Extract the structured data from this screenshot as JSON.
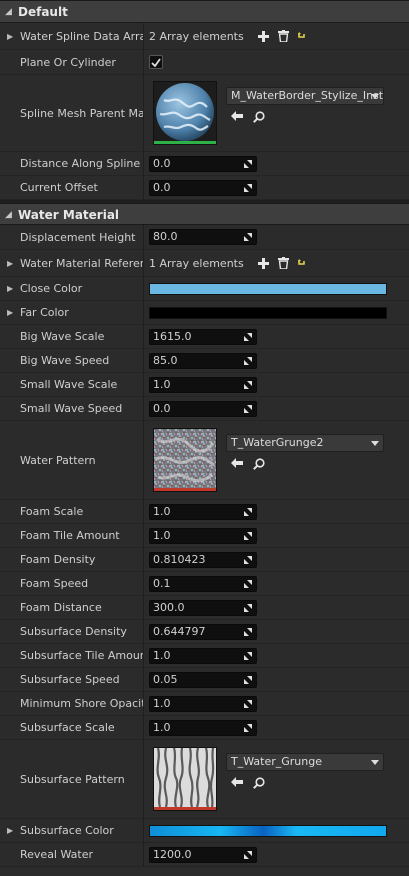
{
  "categories": {
    "default": "Default",
    "water_material": "Water Material"
  },
  "default_rows": {
    "water_spline_data_array": {
      "label": "Water Spline Data Array",
      "value": "2 Array elements"
    },
    "plane_or_cylinder": {
      "label": "Plane Or Cylinder",
      "checked": true
    },
    "spline_mesh_parent": {
      "label": "Spline Mesh Parent Material",
      "asset": "M_WaterBorder_Stylize_Inst"
    },
    "distance_along_spline": {
      "label": "Distance Along Spline",
      "value": "0.0"
    },
    "current_offset": {
      "label": "Current Offset",
      "value": "0.0"
    }
  },
  "water_rows": {
    "displacement_height": {
      "label": "Displacement Height",
      "value": "80.0"
    },
    "water_material_reference": {
      "label": "Water Material Reference",
      "value": "1 Array elements"
    },
    "close_color": {
      "label": "Close Color",
      "color": "#6ab8e2"
    },
    "far_color": {
      "label": "Far Color",
      "color": "#000000"
    },
    "big_wave_scale": {
      "label": "Big Wave Scale",
      "value": "1615.0"
    },
    "big_wave_speed": {
      "label": "Big Wave Speed",
      "value": "85.0"
    },
    "small_wave_scale": {
      "label": "Small Wave Scale",
      "value": "1.0"
    },
    "small_wave_speed": {
      "label": "Small Wave Speed",
      "value": "0.0"
    },
    "water_pattern": {
      "label": "Water Pattern",
      "asset": "T_WaterGrunge2"
    },
    "foam_scale": {
      "label": "Foam Scale",
      "value": "1.0"
    },
    "foam_tile_amount": {
      "label": "Foam Tile Amount",
      "value": "1.0"
    },
    "foam_density": {
      "label": "Foam Density",
      "value": "0.810423"
    },
    "foam_speed": {
      "label": "Foam Speed",
      "value": "0.1"
    },
    "foam_distance": {
      "label": "Foam Distance",
      "value": "300.0"
    },
    "subsurface_density": {
      "label": "Subsurface Density",
      "value": "0.644797"
    },
    "subsurface_tile_amount": {
      "label": "Subsurface Tile Amount",
      "value": "1.0"
    },
    "subsurface_speed": {
      "label": "Subsurface Speed",
      "value": "0.05"
    },
    "minimum_shore_opacity": {
      "label": "Minimum Shore Opacity",
      "value": "1.0"
    },
    "subsurface_scale": {
      "label": "Subsurface Scale",
      "value": "1.0"
    },
    "subsurface_pattern": {
      "label": "Subsurface Pattern",
      "asset": "T_Water_Grunge"
    },
    "subsurface_color": {
      "label": "Subsurface Color",
      "color": "#12a8ee"
    },
    "reveal_water": {
      "label": "Reveal Water",
      "value": "1200.0"
    }
  },
  "icons": {
    "add": "plus-icon",
    "delete": "trash-icon",
    "reset": "reset-arrow-icon",
    "use_selected": "back-arrow-icon",
    "browse": "magnifier-icon"
  },
  "accent_colors": {
    "material_thumb_line": "#2fb14a",
    "texture_thumb_line": "#c0392b",
    "reset_icon": "#e8d44d"
  }
}
